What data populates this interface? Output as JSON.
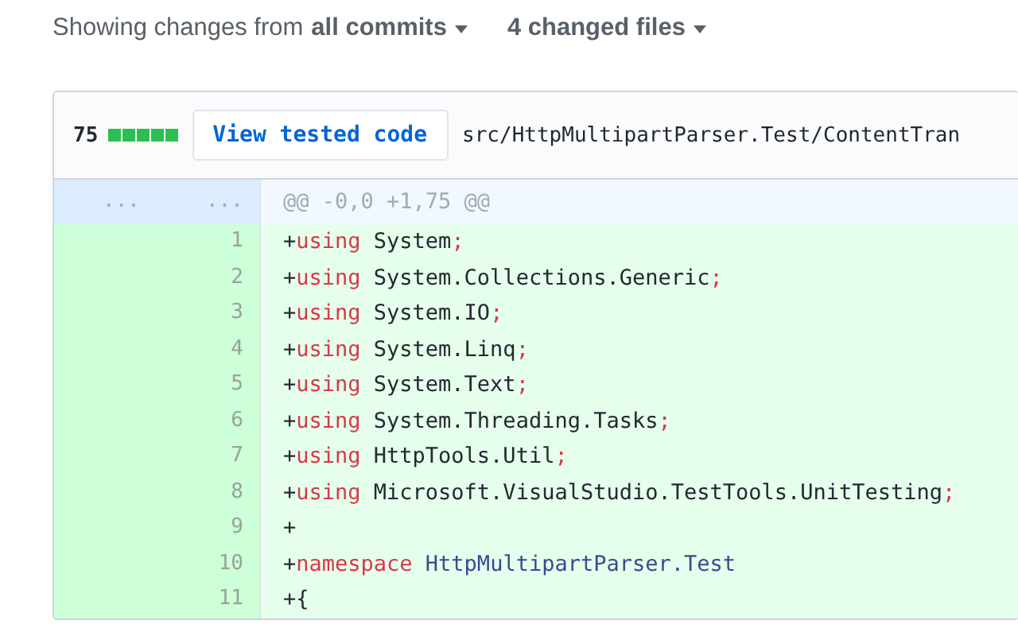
{
  "summary": {
    "prefix": "Showing changes from",
    "commits_menu": "all commits",
    "files_menu": "4 changed files"
  },
  "file": {
    "additions": "75",
    "diffstat": [
      {
        "kind": "added"
      },
      {
        "kind": "added"
      },
      {
        "kind": "added"
      },
      {
        "kind": "added"
      },
      {
        "kind": "added"
      }
    ],
    "view_button": "View tested code",
    "path": "src/HttpMultipartParser.Test/ContentTran",
    "rows": [
      {
        "kind": "hunk",
        "old": "...",
        "new": "...",
        "tokens": [
          {
            "kind": "meta",
            "text": "@@ -0,0 +1,75 @@"
          }
        ]
      },
      {
        "kind": "addition",
        "new": "1",
        "tokens": [
          {
            "kind": "plain",
            "text": "+"
          },
          {
            "kind": "keyword",
            "text": "using"
          },
          {
            "kind": "plain",
            "text": " System"
          },
          {
            "kind": "punct",
            "text": ";"
          }
        ]
      },
      {
        "kind": "addition",
        "new": "2",
        "tokens": [
          {
            "kind": "plain",
            "text": "+"
          },
          {
            "kind": "keyword",
            "text": "using"
          },
          {
            "kind": "plain",
            "text": " System.Collections.Generic"
          },
          {
            "kind": "punct",
            "text": ";"
          }
        ]
      },
      {
        "kind": "addition",
        "new": "3",
        "tokens": [
          {
            "kind": "plain",
            "text": "+"
          },
          {
            "kind": "keyword",
            "text": "using"
          },
          {
            "kind": "plain",
            "text": " System.IO"
          },
          {
            "kind": "punct",
            "text": ";"
          }
        ]
      },
      {
        "kind": "addition",
        "new": "4",
        "tokens": [
          {
            "kind": "plain",
            "text": "+"
          },
          {
            "kind": "keyword",
            "text": "using"
          },
          {
            "kind": "plain",
            "text": " System.Linq"
          },
          {
            "kind": "punct",
            "text": ";"
          }
        ]
      },
      {
        "kind": "addition",
        "new": "5",
        "tokens": [
          {
            "kind": "plain",
            "text": "+"
          },
          {
            "kind": "keyword",
            "text": "using"
          },
          {
            "kind": "plain",
            "text": " System.Text"
          },
          {
            "kind": "punct",
            "text": ";"
          }
        ]
      },
      {
        "kind": "addition",
        "new": "6",
        "tokens": [
          {
            "kind": "plain",
            "text": "+"
          },
          {
            "kind": "keyword",
            "text": "using"
          },
          {
            "kind": "plain",
            "text": " System.Threading.Tasks"
          },
          {
            "kind": "punct",
            "text": ";"
          }
        ]
      },
      {
        "kind": "addition",
        "new": "7",
        "tokens": [
          {
            "kind": "plain",
            "text": "+"
          },
          {
            "kind": "keyword",
            "text": "using"
          },
          {
            "kind": "plain",
            "text": " HttpTools.Util"
          },
          {
            "kind": "punct",
            "text": ";"
          }
        ]
      },
      {
        "kind": "addition",
        "new": "8",
        "tokens": [
          {
            "kind": "plain",
            "text": "+"
          },
          {
            "kind": "keyword",
            "text": "using"
          },
          {
            "kind": "plain",
            "text": " Microsoft.VisualStudio.TestTools.UnitTesting"
          },
          {
            "kind": "punct",
            "text": ";"
          }
        ]
      },
      {
        "kind": "addition",
        "new": "9",
        "tokens": [
          {
            "kind": "plain",
            "text": "+"
          }
        ]
      },
      {
        "kind": "addition",
        "new": "10",
        "tokens": [
          {
            "kind": "plain",
            "text": "+"
          },
          {
            "kind": "keyword",
            "text": "namespace"
          },
          {
            "kind": "entity",
            "text": " HttpMultipartParser.Test"
          }
        ]
      },
      {
        "kind": "addition",
        "new": "11",
        "tokens": [
          {
            "kind": "plain",
            "text": "+{"
          }
        ]
      }
    ]
  }
}
